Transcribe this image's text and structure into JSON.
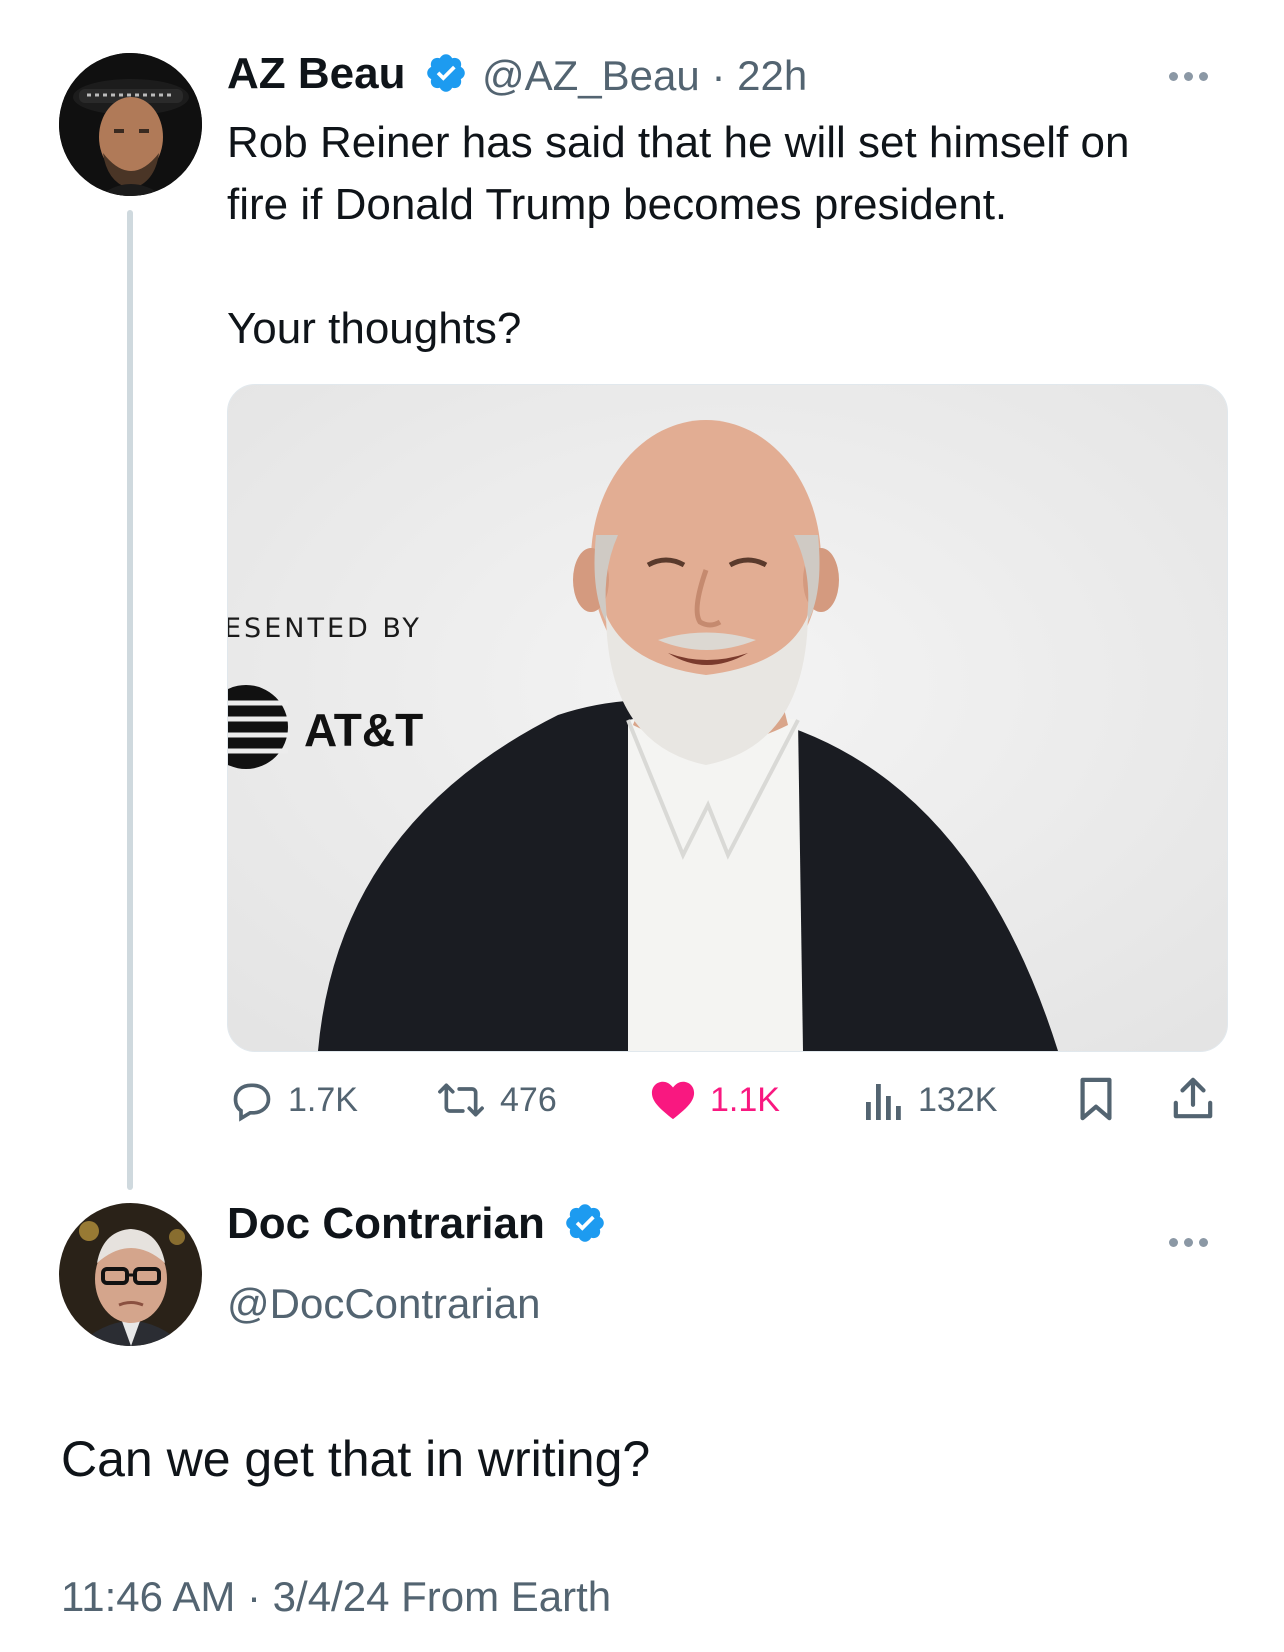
{
  "tweet": {
    "author_name": "AZ Beau",
    "author_handle": "@AZ_Beau",
    "separator": "·",
    "time_ago": "22h",
    "text_line1": "Rob Reiner has said that he will set himself on",
    "text_line2": "fire if Donald Trump becomes president.",
    "text_line3": "Your thoughts?",
    "media": {
      "backdrop_text": "ESENTED BY",
      "sponsor_logo_text": "AT&T"
    },
    "stats": {
      "replies": "1.7K",
      "retweets": "476",
      "likes": "1.1K",
      "views": "132K"
    }
  },
  "reply": {
    "author_name": "Doc Contrarian",
    "author_handle": "@DocContrarian",
    "text": "Can we get that in writing?",
    "timestamp": "11:46 AM · 3/4/24 From Earth"
  },
  "colors": {
    "verified": "#1d9bf0",
    "like": "#f91880",
    "muted": "#536471",
    "thread_line": "#cfd9de"
  }
}
